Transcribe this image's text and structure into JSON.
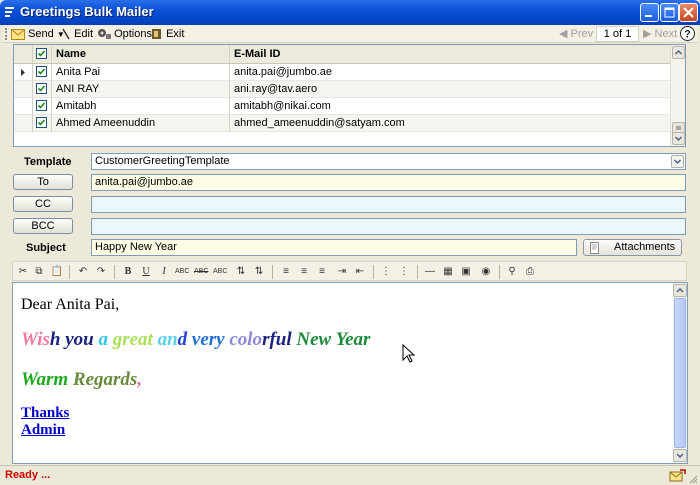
{
  "window": {
    "title": "Greetings Bulk Mailer"
  },
  "toolbar": {
    "send_label": "Send",
    "edit_label": "Edit",
    "options_label": "Options",
    "exit_label": "Exit",
    "prev_label": "Prev",
    "page_count": "1 of 1",
    "next_label": "Next"
  },
  "grid": {
    "columns": [
      "Name",
      "E-Mail ID"
    ],
    "rows": [
      {
        "checked": true,
        "name": "Anita Pai",
        "email": "anita.pai@jumbo.ae"
      },
      {
        "checked": true,
        "name": "ANI RAY",
        "email": "ani.ray@tav.aero"
      },
      {
        "checked": true,
        "name": "Amitabh",
        "email": "amitabh@nikai.com"
      },
      {
        "checked": true,
        "name": "Ahmed Ameenuddin",
        "email": "ahmed_ameenuddin@satyam.com"
      }
    ]
  },
  "form": {
    "template_label": "Template",
    "template_value": "CustomerGreetingTemplate",
    "to_label": "To",
    "to_value": "anita.pai@jumbo.ae",
    "cc_label": "CC",
    "cc_value": "",
    "bcc_label": "BCC",
    "bcc_value": "",
    "subject_label": "Subject",
    "subject_value": "Happy New Year",
    "attachments_label": "Attachments"
  },
  "editor": {
    "greeting": "Dear Anita Pai,",
    "wish_segments": [
      {
        "text": "Wis",
        "color": "#f27ba0"
      },
      {
        "text": "h you ",
        "color": "#1a237e"
      },
      {
        "text": "a ",
        "color": "#33c4e8"
      },
      {
        "text": "great ",
        "color": "#a9e05a"
      },
      {
        "text": "an",
        "color": "#5ad1e8"
      },
      {
        "text": "d ",
        "color": "#1f3fd6"
      },
      {
        "text": "very ",
        "color": "#1e6fd8"
      },
      {
        "text": "colo",
        "color": "#8a8ad6"
      },
      {
        "text": "rful ",
        "color": "#1a237e"
      },
      {
        "text": "New Year",
        "color": "#1e8a3c"
      }
    ],
    "regards_segments": [
      {
        "text": "Warm ",
        "color": "#1eaa1e"
      },
      {
        "text": "Regards",
        "color": "#6a8a3c"
      },
      {
        "text": ",",
        "color": "#e86ba0"
      }
    ],
    "thanks": "Thanks",
    "admin": "Admin"
  },
  "status": {
    "text": "Ready ..."
  }
}
